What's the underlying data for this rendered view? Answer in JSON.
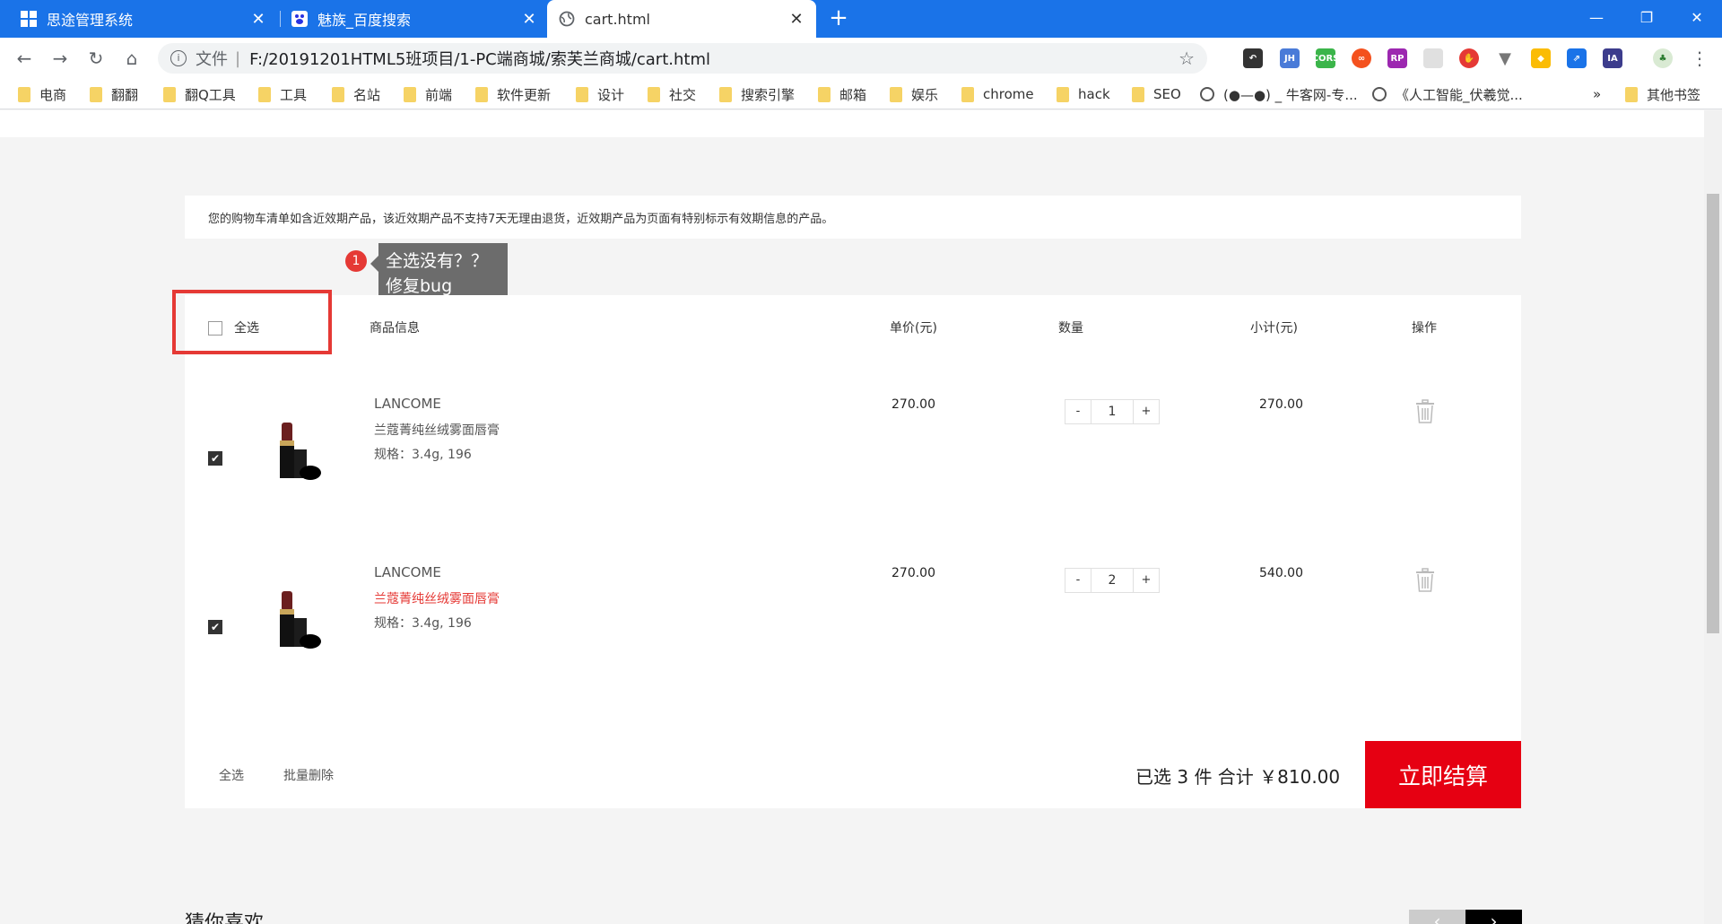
{
  "browser": {
    "tabs": [
      {
        "title": "思途管理系统",
        "icon": "windows-icon"
      },
      {
        "title": "魅族_百度搜索",
        "icon": "baidu-paw-icon"
      },
      {
        "title": "cart.html",
        "icon": "globe-icon"
      }
    ],
    "window_controls": {
      "minimize": "—",
      "maximize": "❐",
      "close": "✕"
    },
    "address": {
      "scheme_label": "文件",
      "url": "F:/20191201HTML5班项目/1-PC端商城/索芙兰商城/cart.html"
    },
    "bookmarks": [
      {
        "label": "电商",
        "type": "folder"
      },
      {
        "label": "翻翻",
        "type": "folder"
      },
      {
        "label": "翻Q工具",
        "type": "folder"
      },
      {
        "label": "工具",
        "type": "folder"
      },
      {
        "label": "名站",
        "type": "folder"
      },
      {
        "label": "前端",
        "type": "folder"
      },
      {
        "label": "软件更新",
        "type": "folder"
      },
      {
        "label": "设计",
        "type": "folder"
      },
      {
        "label": "社交",
        "type": "folder"
      },
      {
        "label": "搜索引擎",
        "type": "folder"
      },
      {
        "label": "邮箱",
        "type": "folder"
      },
      {
        "label": "娱乐",
        "type": "folder"
      },
      {
        "label": "chrome",
        "type": "folder"
      },
      {
        "label": "hack",
        "type": "folder"
      },
      {
        "label": "SEO",
        "type": "folder"
      },
      {
        "label": "(●—●) _ 牛客网-专...",
        "type": "site"
      },
      {
        "label": "《人工智能_伏羲觉...",
        "type": "site"
      }
    ],
    "bookmarks_overflow": "»",
    "other_bookmarks": "其他书签"
  },
  "page": {
    "notice": "您的购物车清单如含近效期产品，该近效期产品不支持7天无理由退货，近效期产品为页面有特别标示有效期信息的产品。",
    "annotation": {
      "number": "1",
      "line1": "全选没有？？",
      "line2": "修复bug"
    },
    "header": {
      "select_all": "全选",
      "product_info": "商品信息",
      "unit_price": "单价(元)",
      "quantity": "数量",
      "subtotal": "小计(元)",
      "actions": "操作"
    },
    "items": [
      {
        "checked": true,
        "brand": "LANCOME",
        "name": "兰蔻菁纯丝绒雾面唇膏",
        "spec": "规格：3.4g, 196",
        "price": "270.00",
        "qty": "1",
        "subtotal": "270.00",
        "minus": "-",
        "plus": "+"
      },
      {
        "checked": true,
        "brand": "LANCOME",
        "name": "兰蔻菁纯丝绒雾面唇膏",
        "spec": "规格：3.4g, 196",
        "price": "270.00",
        "qty": "2",
        "subtotal": "540.00",
        "minus": "-",
        "plus": "+"
      }
    ],
    "footer": {
      "select_all": "全选",
      "batch_delete": "批量删除",
      "summary": "已选 3 件 合计 ￥810.00",
      "checkout": "立即结算"
    },
    "guess_title": "猜你喜欢",
    "carousel": {
      "prev": "‹",
      "next": "›"
    },
    "colors": {
      "accent_red": "#e60012",
      "chrome_blue": "#1a73e8",
      "annotation_red": "#e53935"
    }
  }
}
